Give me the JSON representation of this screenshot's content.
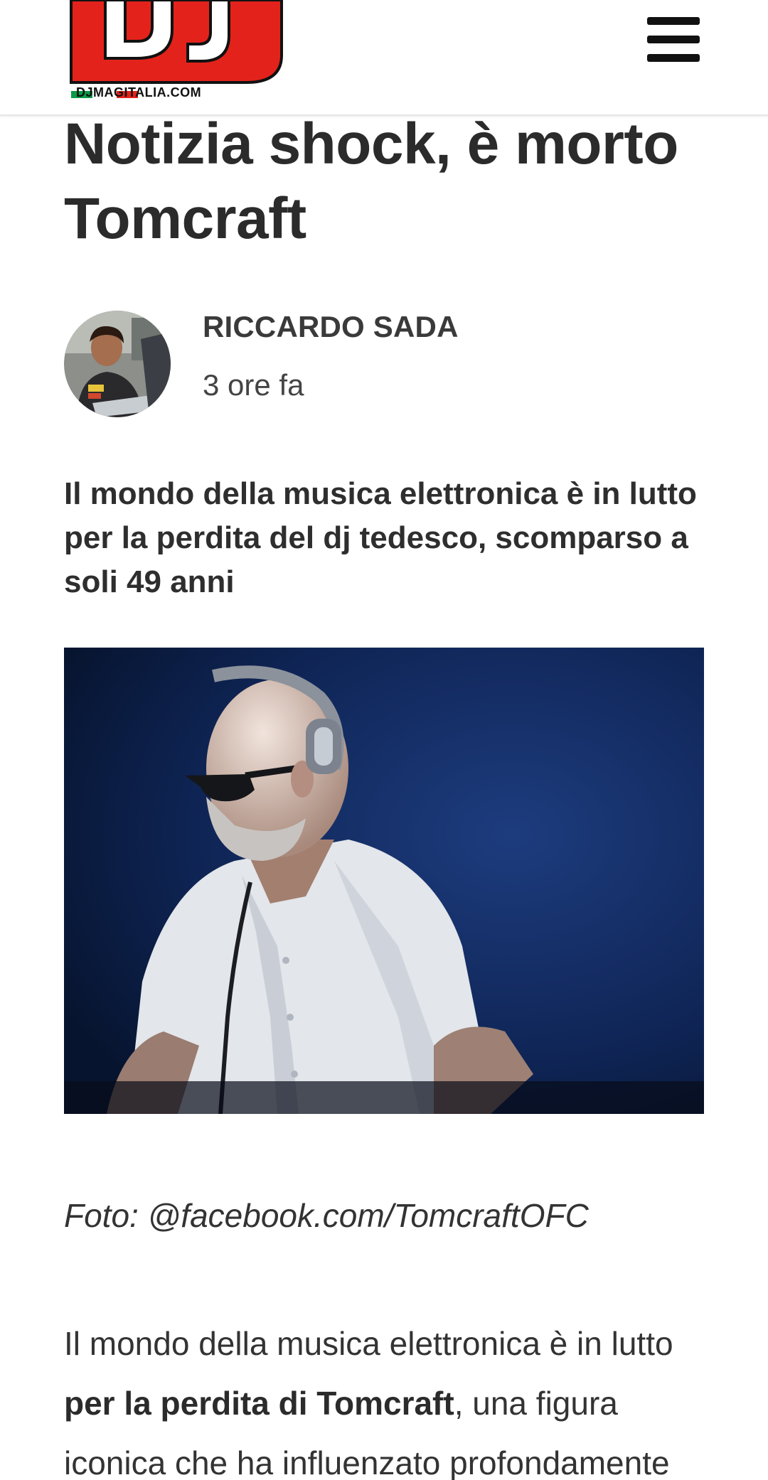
{
  "site": {
    "logo_letters": "DJ",
    "domain": "DJMAGITALIA.COM",
    "brand_red": "#e3231b",
    "flag_green": "#0a9a48"
  },
  "header": {
    "menu_icon": "hamburger-menu-icon"
  },
  "article": {
    "title": "Notizia shock, è morto Tomcraft",
    "author": "RICCARDO SADA",
    "time": "3 ore fa",
    "lead": "Il mondo della musica elettronica è in lutto per la perdita del dj tedesco, scomparso a soli 49 anni",
    "caption": "Foto: @facebook.com/TomcraftOFC",
    "body_prefix": "Il mondo della musica elettronica è in lutto ",
    "body_bold": "per la perdita di Tomcraft",
    "body_suffix": ", una figura iconica che ha influenzato profondamente"
  },
  "colors": {
    "text": "#2b2b2b",
    "photo_bg": "#0d1f48"
  }
}
